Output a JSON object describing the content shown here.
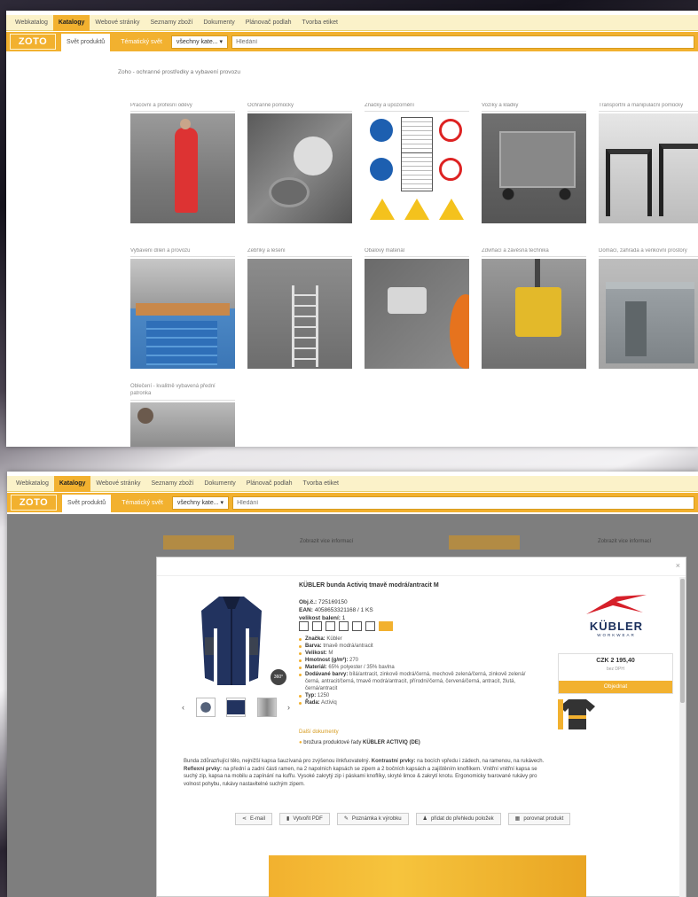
{
  "nav": {
    "items": [
      "Webkatalog",
      "Katalogy",
      "Webové stránky",
      "Seznamy zboží",
      "Dokumenty",
      "Plánovač podlah",
      "Tvorba etiket"
    ],
    "active_index": 1
  },
  "search": {
    "logo": "ZOTO",
    "tab_active": "Svět produktů",
    "tab_other": "Tématický svět",
    "category_select": "všechny kate...",
    "placeholder": "Hledání"
  },
  "catalog": {
    "breadcrumb": "Zoho - ochranné prostředky a vybavení provozu",
    "tiles": [
      {
        "label": "Pracovní a profesní oděvy"
      },
      {
        "label": "Ochranné pomůcky"
      },
      {
        "label": "Značky a upozornění"
      },
      {
        "label": "Vozíky a kladky"
      },
      {
        "label": "Transportní a manipulační pomůcky"
      },
      {
        "label": "Vybavení dílen a provozu"
      },
      {
        "label": "Žebříky a lešení"
      },
      {
        "label": "Obalový materiál"
      },
      {
        "label": "Zdvihací a závěsná technika"
      },
      {
        "label": "Domácí, zahrada a venkovní prostory"
      },
      {
        "label": "Oblečení - kvalitně vybavená přední patronka"
      }
    ]
  },
  "backdrop": {
    "tab_label": "Detailní informace",
    "header_text": "Zobrazit vice informací"
  },
  "product": {
    "title": "KÜBLER bunda Activiq tmavě modrá/antracit M",
    "order_no_label": "Obj.č.:",
    "order_no": "725169150",
    "ean_label": "EAN:",
    "ean": "4058653321168 / 1 KS",
    "pack_label": "velikost balení:",
    "pack": "1",
    "properties": [
      {
        "label": "Značka:",
        "value": "Kübler"
      },
      {
        "label": "Barva:",
        "value": "tmavě modrá/antracit"
      },
      {
        "label": "Velikost:",
        "value": "M"
      },
      {
        "label": "Hmotnost (g/m²):",
        "value": "270"
      },
      {
        "label": "Materiál:",
        "value": "65% polyester / 35% bavlna"
      },
      {
        "label": "Dodávané barvy:",
        "value": "bílá/antracit, zinkově modrá/černá, mechově zelená/černá, zinkově zelená/černá, antracit/černá, tmavě modrá/antracit, přírodní/černá, červená/černá, antracit, žlutá, černá/antracit"
      },
      {
        "label": "Typ:",
        "value": "1250"
      },
      {
        "label": "Řada:",
        "value": "Activiq"
      }
    ],
    "more_link": "Další dokumenty",
    "sheet_label": "brožura produktové řady",
    "sheet_name": "KÜBLER ACTIVIQ (DE)",
    "description_pre": "Bunda zdůrazňující tělo, nejnižší kapsa šauzívaná pro zvýšenou ilnkfuovatelný.",
    "kw1": "Kontrastní prvky:",
    "description_mid": "na bocích vpředu i zádech, na ramenou, na rukávech.",
    "kw2": "Reflexní prvky:",
    "description_post": "na přední a zadní části ramen, na 2 napolních kapsách se zipem a 2 bočních kapsách a zajištěním knoflíkem. Vnitřní vnitřní kapsa se suchý zip, kapsa na mobilu a zapínání na kufřu. Vysoké zakrytý zip i páskami knoflíky, skryté limce & zakrytí knotu. Ergonomicky tvarované rukávy pro volnost pohybu, rukávy nastavitelné suchým zipem.",
    "brand_name": "KÜBLER",
    "brand_sub": "WORKWEAR",
    "price": "CZK 2 195,40",
    "vat": "bez DPH",
    "buy_label": "Objednat",
    "actions": [
      "E-mail",
      "Vytvořit PDF",
      "Poznámka k výrobku",
      "přidat do přehledu položek",
      "porovnat produkt"
    ],
    "close": "×"
  },
  "colors": {
    "accent": "#f2b12f",
    "menu_bg": "#fbf2c9",
    "brand_red": "#d6202a",
    "brand_blue": "#1a2f5c"
  }
}
